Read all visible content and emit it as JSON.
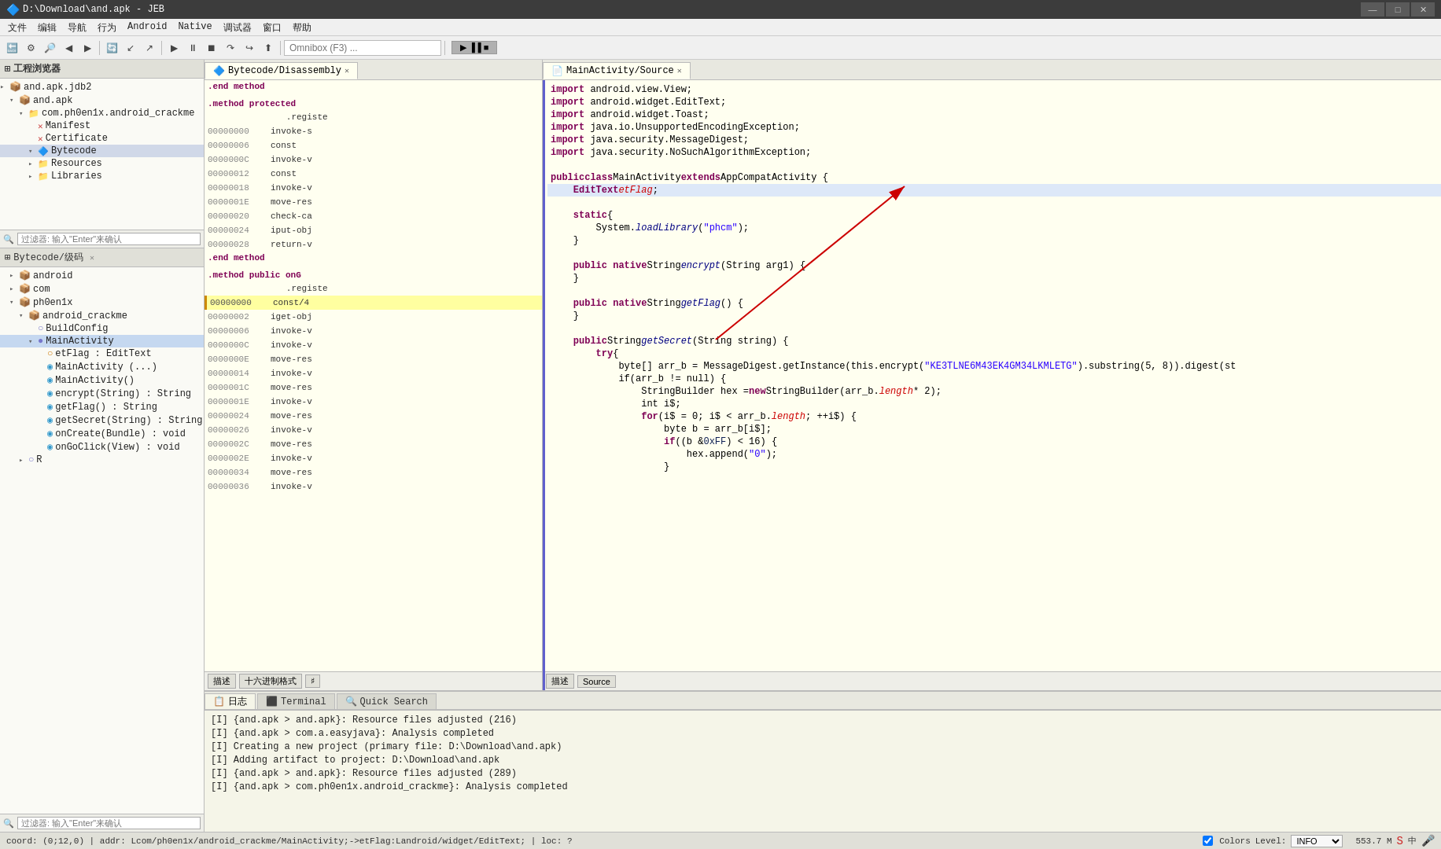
{
  "titlebar": {
    "title": "D:\\Download\\and.apk - JEB",
    "min_label": "—",
    "max_label": "□",
    "close_label": "✕"
  },
  "menubar": {
    "items": [
      "文件",
      "编辑",
      "导航",
      "行为",
      "Android",
      "Native",
      "调试器",
      "窗口",
      "帮助"
    ]
  },
  "toolbar": {
    "omnibox_placeholder": "Omnibox (F3) ...",
    "run_label": "▶ ▐▐ ■ ↶"
  },
  "left_panel": {
    "project_header": "工程浏览器",
    "filter_placeholder": "过滤器: 输入\"Enter\"来确认",
    "tree": [
      {
        "label": "and.apk.jdb2",
        "level": 0,
        "icon": "▸",
        "type": "root"
      },
      {
        "label": "and.apk",
        "level": 1,
        "icon": "▾",
        "type": "folder"
      },
      {
        "label": "com.ph0en1x.android_crackme",
        "level": 2,
        "icon": "▾",
        "type": "package"
      },
      {
        "label": "Manifest",
        "level": 3,
        "icon": "✕",
        "type": "file"
      },
      {
        "label": "Certificate",
        "level": 3,
        "icon": "✕",
        "type": "file"
      },
      {
        "label": "Bytecode",
        "level": 3,
        "icon": "▾",
        "type": "folder",
        "highlight": true
      },
      {
        "label": "Resources",
        "level": 3,
        "icon": "▸",
        "type": "folder"
      },
      {
        "label": "Libraries",
        "level": 3,
        "icon": "▸",
        "type": "folder"
      }
    ]
  },
  "bytecode_panel": {
    "header": "Bytecode/级码",
    "filter_placeholder": "过滤器: 输入\"Enter\"来确认",
    "tree": [
      {
        "label": "android",
        "level": 0,
        "icon": "▸",
        "type": "package"
      },
      {
        "label": "com",
        "level": 0,
        "icon": "▸",
        "type": "package"
      },
      {
        "label": "ph0en1x",
        "level": 0,
        "icon": "▾",
        "type": "package"
      },
      {
        "label": "android_crackme",
        "level": 1,
        "icon": "▾",
        "type": "package"
      },
      {
        "label": "BuildConfig",
        "level": 2,
        "icon": "○",
        "type": "class"
      },
      {
        "label": "MainActivity",
        "level": 2,
        "icon": "●",
        "type": "class",
        "selected": true
      },
      {
        "label": "etFlag : EditText",
        "level": 3,
        "icon": "○",
        "type": "field"
      },
      {
        "label": "MainActivity (...)",
        "level": 3,
        "icon": "◉",
        "type": "method"
      },
      {
        "label": "MainActivity()",
        "level": 3,
        "icon": "◉",
        "type": "method"
      },
      {
        "label": "encrypt(String) : String",
        "level": 3,
        "icon": "◉",
        "type": "method"
      },
      {
        "label": "getFlag() : String",
        "level": 3,
        "icon": "◉",
        "type": "method"
      },
      {
        "label": "getSecret(String) : String",
        "level": 3,
        "icon": "◉",
        "type": "method"
      },
      {
        "label": "onCreate(Bundle) : void",
        "level": 3,
        "icon": "◉",
        "type": "method"
      },
      {
        "label": "onGoClick(View) : void",
        "level": 3,
        "icon": "◉",
        "type": "method"
      },
      {
        "label": "R",
        "level": 1,
        "icon": "▸",
        "type": "class"
      }
    ],
    "footer_tabs": [
      "描述",
      "十六进制格式",
      "♯"
    ]
  },
  "disassembly_tab": {
    "label": "Bytecode/Disassembly",
    "close": "✕",
    "rows": [
      {
        "type": "section",
        "text": ".end method"
      },
      {
        "type": "blank"
      },
      {
        "type": "section",
        "text": ".method protected"
      },
      {
        "addr": "",
        "op": "   .registe"
      },
      {
        "addr": "00000000",
        "op": "invoke-s"
      },
      {
        "addr": "00000006",
        "op": "const"
      },
      {
        "addr": "0000000C",
        "op": "invoke-v"
      },
      {
        "addr": "00000012",
        "op": "const"
      },
      {
        "addr": "00000018",
        "op": "invoke-v"
      },
      {
        "addr": "0000001E",
        "op": "move-res"
      },
      {
        "addr": "00000020",
        "op": "check-ca"
      },
      {
        "addr": "00000024",
        "op": "iput-obj"
      },
      {
        "addr": "00000028",
        "op": "return-v"
      },
      {
        "type": "section",
        "text": ".end method"
      },
      {
        "type": "blank"
      },
      {
        "type": "section",
        "text": ".method public onG"
      },
      {
        "addr": "",
        "op": "   .registe"
      },
      {
        "addr": "00000000",
        "op": "const/4",
        "highlighted": true
      },
      {
        "addr": "00000002",
        "op": "iget-obj"
      },
      {
        "addr": "00000006",
        "op": "invoke-v"
      },
      {
        "addr": "0000000C",
        "op": "invoke-v"
      },
      {
        "addr": "0000000E",
        "op": "move-res"
      },
      {
        "addr": "00000014",
        "op": "invoke-v"
      },
      {
        "addr": "0000001C",
        "op": "move-res"
      },
      {
        "addr": "0000001E",
        "op": "invoke-v"
      },
      {
        "addr": "00000024",
        "op": "move-res"
      },
      {
        "addr": "00000026",
        "op": "invoke-v"
      },
      {
        "addr": "0000002C",
        "op": "move-res"
      },
      {
        "addr": "0000002E",
        "op": "invoke-v"
      },
      {
        "addr": "00000034",
        "op": "move-res"
      },
      {
        "addr": "00000036",
        "op": "invoke-v"
      }
    ]
  },
  "source_tab": {
    "label": "MainActivity/Source",
    "close": "✕",
    "footer_tabs": [
      "描述",
      "Source"
    ]
  },
  "code_lines": [
    {
      "num": "",
      "tokens": [
        {
          "t": "import",
          "cls": "kw"
        },
        {
          "t": " android.view.View;",
          "cls": ""
        }
      ]
    },
    {
      "num": "",
      "tokens": [
        {
          "t": "import",
          "cls": "kw"
        },
        {
          "t": " android.widget.EditText;",
          "cls": ""
        }
      ]
    },
    {
      "num": "",
      "tokens": [
        {
          "t": "import",
          "cls": "kw"
        },
        {
          "t": " android.widget.Toast;",
          "cls": ""
        }
      ]
    },
    {
      "num": "",
      "tokens": [
        {
          "t": "import",
          "cls": "kw"
        },
        {
          "t": " java.io.UnsupportedEncodingException;",
          "cls": ""
        }
      ]
    },
    {
      "num": "",
      "tokens": [
        {
          "t": "import",
          "cls": "kw"
        },
        {
          "t": " java.security.MessageDigest;",
          "cls": ""
        }
      ]
    },
    {
      "num": "",
      "tokens": [
        {
          "t": "import",
          "cls": "kw"
        },
        {
          "t": " java.security.NoSuchAlgorithmException;",
          "cls": ""
        }
      ]
    },
    {
      "num": "",
      "tokens": []
    },
    {
      "num": "",
      "tokens": [
        {
          "t": "public ",
          "cls": "kw"
        },
        {
          "t": "class ",
          "cls": "kw"
        },
        {
          "t": "MainActivity ",
          "cls": ""
        },
        {
          "t": "extends ",
          "cls": "kw"
        },
        {
          "t": "AppCompatActivity {",
          "cls": ""
        }
      ]
    },
    {
      "num": "",
      "tokens": [
        {
          "t": "    EditText ",
          "cls": "kw"
        },
        {
          "t": "etFlag",
          "cls": "var-name"
        },
        {
          "t": ";",
          "cls": ""
        }
      ],
      "highlighted": true
    },
    {
      "num": "",
      "tokens": []
    },
    {
      "num": "",
      "tokens": [
        {
          "t": "    ",
          "cls": ""
        },
        {
          "t": "static",
          "cls": "kw"
        },
        {
          "t": " {",
          "cls": ""
        }
      ]
    },
    {
      "num": "",
      "tokens": [
        {
          "t": "        System.",
          "cls": ""
        },
        {
          "t": "loadLibrary",
          "cls": "method"
        },
        {
          "t": "(",
          "cls": ""
        },
        {
          "t": "\"phcm\"",
          "cls": "str"
        },
        {
          "t": ");",
          "cls": ""
        }
      ]
    },
    {
      "num": "",
      "tokens": [
        {
          "t": "    }",
          "cls": ""
        }
      ]
    },
    {
      "num": "",
      "tokens": []
    },
    {
      "num": "",
      "tokens": [
        {
          "t": "    ",
          "cls": ""
        },
        {
          "t": "public native ",
          "cls": "kw"
        },
        {
          "t": "String ",
          "cls": ""
        },
        {
          "t": "encrypt",
          "cls": "method"
        },
        {
          "t": "(",
          "cls": ""
        },
        {
          "t": "String ",
          "cls": ""
        },
        {
          "t": "arg1) {",
          "cls": ""
        }
      ]
    },
    {
      "num": "",
      "tokens": [
        {
          "t": "    }",
          "cls": ""
        }
      ]
    },
    {
      "num": "",
      "tokens": []
    },
    {
      "num": "",
      "tokens": [
        {
          "t": "    ",
          "cls": ""
        },
        {
          "t": "public native ",
          "cls": "kw"
        },
        {
          "t": "String ",
          "cls": ""
        },
        {
          "t": "getFlag",
          "cls": "method"
        },
        {
          "t": "() {",
          "cls": ""
        }
      ]
    },
    {
      "num": "",
      "tokens": [
        {
          "t": "    }",
          "cls": ""
        }
      ]
    },
    {
      "num": "",
      "tokens": []
    },
    {
      "num": "",
      "tokens": [
        {
          "t": "    ",
          "cls": ""
        },
        {
          "t": "public ",
          "cls": "kw"
        },
        {
          "t": "String ",
          "cls": ""
        },
        {
          "t": "getSecret",
          "cls": "method"
        },
        {
          "t": "(",
          "cls": ""
        },
        {
          "t": "String ",
          "cls": ""
        },
        {
          "t": "string) {",
          "cls": ""
        }
      ]
    },
    {
      "num": "",
      "tokens": [
        {
          "t": "        ",
          "cls": ""
        },
        {
          "t": "try",
          "cls": "kw"
        },
        {
          "t": " {",
          "cls": ""
        }
      ]
    },
    {
      "num": "",
      "tokens": [
        {
          "t": "            byte[] arr_b = MessageDigest.getInstance(this.encrypt(",
          "cls": ""
        },
        {
          "t": "\"KE3TLNE6M43EK4GM34LKMLETG\"",
          "cls": "str"
        },
        {
          "t": ").substring(5, 8)).digest(st",
          "cls": ""
        }
      ]
    },
    {
      "num": "",
      "tokens": [
        {
          "t": "            if(arr_b != null) {",
          "cls": ""
        }
      ]
    },
    {
      "num": "",
      "tokens": [
        {
          "t": "                StringBuilder hex = ",
          "cls": ""
        },
        {
          "t": "new",
          "cls": "kw"
        },
        {
          "t": " StringBuilder(arr_b.",
          "cls": ""
        },
        {
          "t": "length",
          "cls": "var-name"
        },
        {
          "t": " * 2);",
          "cls": ""
        }
      ]
    },
    {
      "num": "",
      "tokens": [
        {
          "t": "                int i$;",
          "cls": ""
        }
      ]
    },
    {
      "num": "",
      "tokens": [
        {
          "t": "                ",
          "cls": ""
        },
        {
          "t": "for",
          "cls": "kw"
        },
        {
          "t": "(i$ = 0; i$ < arr_b.",
          "cls": ""
        },
        {
          "t": "length",
          "cls": "var-name"
        },
        {
          "t": "; ++i$) {",
          "cls": ""
        }
      ]
    },
    {
      "num": "",
      "tokens": [
        {
          "t": "                    byte b = arr_b[i$];",
          "cls": ""
        }
      ]
    },
    {
      "num": "",
      "tokens": [
        {
          "t": "                    ",
          "cls": ""
        },
        {
          "t": "if",
          "cls": "kw"
        },
        {
          "t": "((b & ",
          "cls": ""
        },
        {
          "t": "0xFF",
          "cls": "number"
        },
        {
          "t": ") < 16) {",
          "cls": ""
        }
      ]
    },
    {
      "num": "",
      "tokens": [
        {
          "t": "                        hex.append(",
          "cls": ""
        },
        {
          "t": "\"0\"",
          "cls": "str"
        },
        {
          "t": ");",
          "cls": ""
        }
      ]
    },
    {
      "num": "",
      "tokens": [
        {
          "t": "                    }",
          "cls": ""
        }
      ]
    }
  ],
  "console": {
    "tabs": [
      "日志",
      "Terminal",
      "Quick Search"
    ],
    "active_tab": "日志",
    "lines": [
      "[I]  {and.apk > and.apk}: Resource files adjusted (216)",
      "[I]  {and.apk > com.a.easyjava}: Analysis completed",
      "[I]  Creating a new project (primary file: D:\\Download\\and.apk)",
      "[I]  Adding artifact to project: D:\\Download\\and.apk",
      "[I]  {and.apk > and.apk}: Resource files adjusted (289)",
      "[I]  {and.apk > com.ph0en1x.android_crackme}: Analysis completed"
    ]
  },
  "status_bar": {
    "coord": "coord: (0;12,0) | addr: Lcom/ph0en1x/android_crackme/MainActivity;->etFlag:Landroid/widget/EditText; | loc: ?",
    "colors_label": "Colors",
    "level_label": "Level:",
    "level_value": "INFO",
    "size_label": "553.7 M"
  },
  "colors": {
    "bg_code": "#fffff0",
    "bg_panel": "#fafaf5",
    "highlight_line": "#dde8f8",
    "bytecode_highlight": "#ffffa0",
    "accent_red": "#cc0000"
  }
}
